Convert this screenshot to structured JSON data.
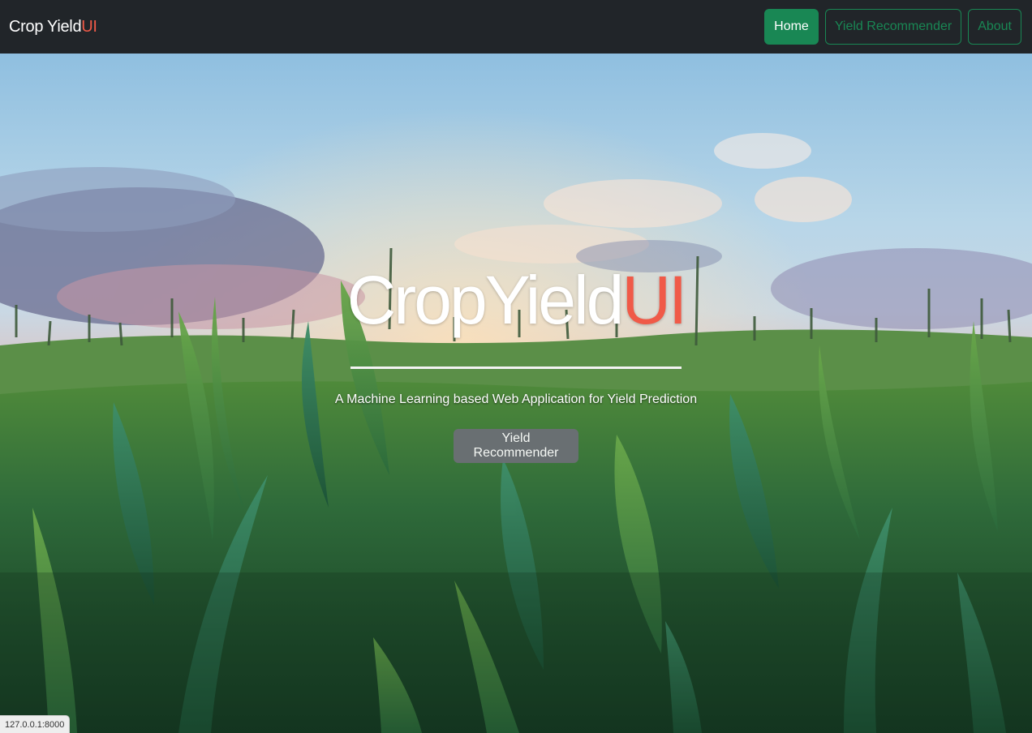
{
  "navbar": {
    "brand_prefix": "Crop Yield",
    "brand_suffix": "UI",
    "buttons": [
      {
        "label": "Home",
        "active": true
      },
      {
        "label": "Yield Recommender",
        "active": false
      },
      {
        "label": "About",
        "active": false
      }
    ]
  },
  "hero": {
    "title_prefix": "CropYield",
    "title_suffix": "UI",
    "subtitle": "A Machine Learning based Web Application for Yield Prediction",
    "cta_label": "Yield Recommender"
  },
  "status_bar": {
    "url": "127.0.0.1:8000"
  },
  "colors": {
    "navbar_bg": "#212529",
    "accent": "#f05a48",
    "success": "#198754",
    "cta_bg": "#6c6f76"
  },
  "icons": [
    "corn-field-photo"
  ]
}
